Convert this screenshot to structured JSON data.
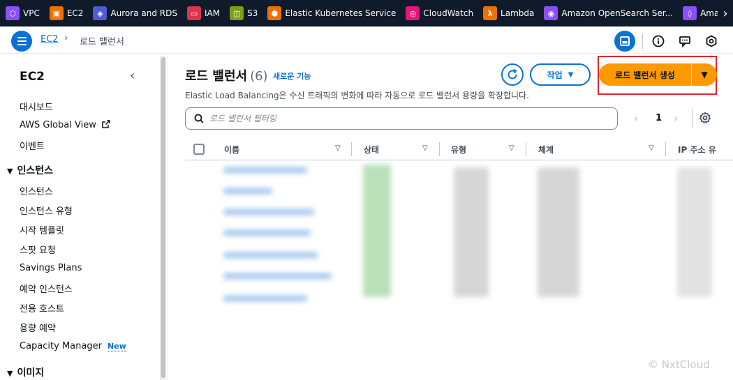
{
  "favorites": [
    {
      "label": "VPC",
      "color": "#8c4fff",
      "glyph": "⬡"
    },
    {
      "label": "EC2",
      "color": "#ed7100",
      "glyph": "▣"
    },
    {
      "label": "Aurora and RDS",
      "color": "#4d5bd9",
      "glyph": "◈"
    },
    {
      "label": "IAM",
      "color": "#dd344c",
      "glyph": "▭"
    },
    {
      "label": "S3",
      "color": "#7aa116",
      "glyph": "◫"
    },
    {
      "label": "Elastic Kubernetes Service",
      "color": "#ed7100",
      "glyph": "⬢"
    },
    {
      "label": "CloudWatch",
      "color": "#e7157b",
      "glyph": "◎"
    },
    {
      "label": "Lambda",
      "color": "#ed7100",
      "glyph": "λ"
    },
    {
      "label": "Amazon OpenSearch Ser...",
      "color": "#8c4fff",
      "glyph": "◉"
    },
    {
      "label": "Amazon Sa",
      "color": "#8c4fff",
      "glyph": "◊"
    }
  ],
  "breadcrumb": {
    "root": "EC2",
    "current": "로드 밸런서"
  },
  "sidebar": {
    "title": "EC2",
    "items": [
      {
        "label": "대시보드"
      },
      {
        "label": "AWS Global View"
      },
      {
        "label": "이벤트"
      }
    ],
    "section_instances": "인스턴스",
    "instance_items": [
      {
        "label": "인스턴스"
      },
      {
        "label": "인스턴스 유형"
      },
      {
        "label": "시작 템플릿"
      },
      {
        "label": "스팟 요청"
      },
      {
        "label": "Savings Plans"
      },
      {
        "label": "예약 인스턴스"
      },
      {
        "label": "전용 호스트"
      },
      {
        "label": "용량 예약"
      },
      {
        "label": "Capacity Manager"
      }
    ],
    "new_badge": "New",
    "section_images": "이미지"
  },
  "main": {
    "title": "로드 밸런서",
    "count": "(6)",
    "info_link": "새로운 기능",
    "description": "Elastic Load Balancing은 수신 트래픽의 변화에 따라 자동으로 로드 밸런서 용량을 확장합니다.",
    "action_label": "작업",
    "create_label": "로드 밸런서 생성",
    "search_placeholder": "로드 밸런서 필터링",
    "page_number": "1",
    "columns": [
      "이름",
      "상태",
      "유형",
      "체계",
      "IP 주소 유"
    ]
  },
  "watermark": "© NxtCloud",
  "colors": {
    "accent": "#0972d3",
    "primary_button": "#ff9900",
    "highlight_box": "#e3262b",
    "topbar": "#0f1b2a"
  }
}
